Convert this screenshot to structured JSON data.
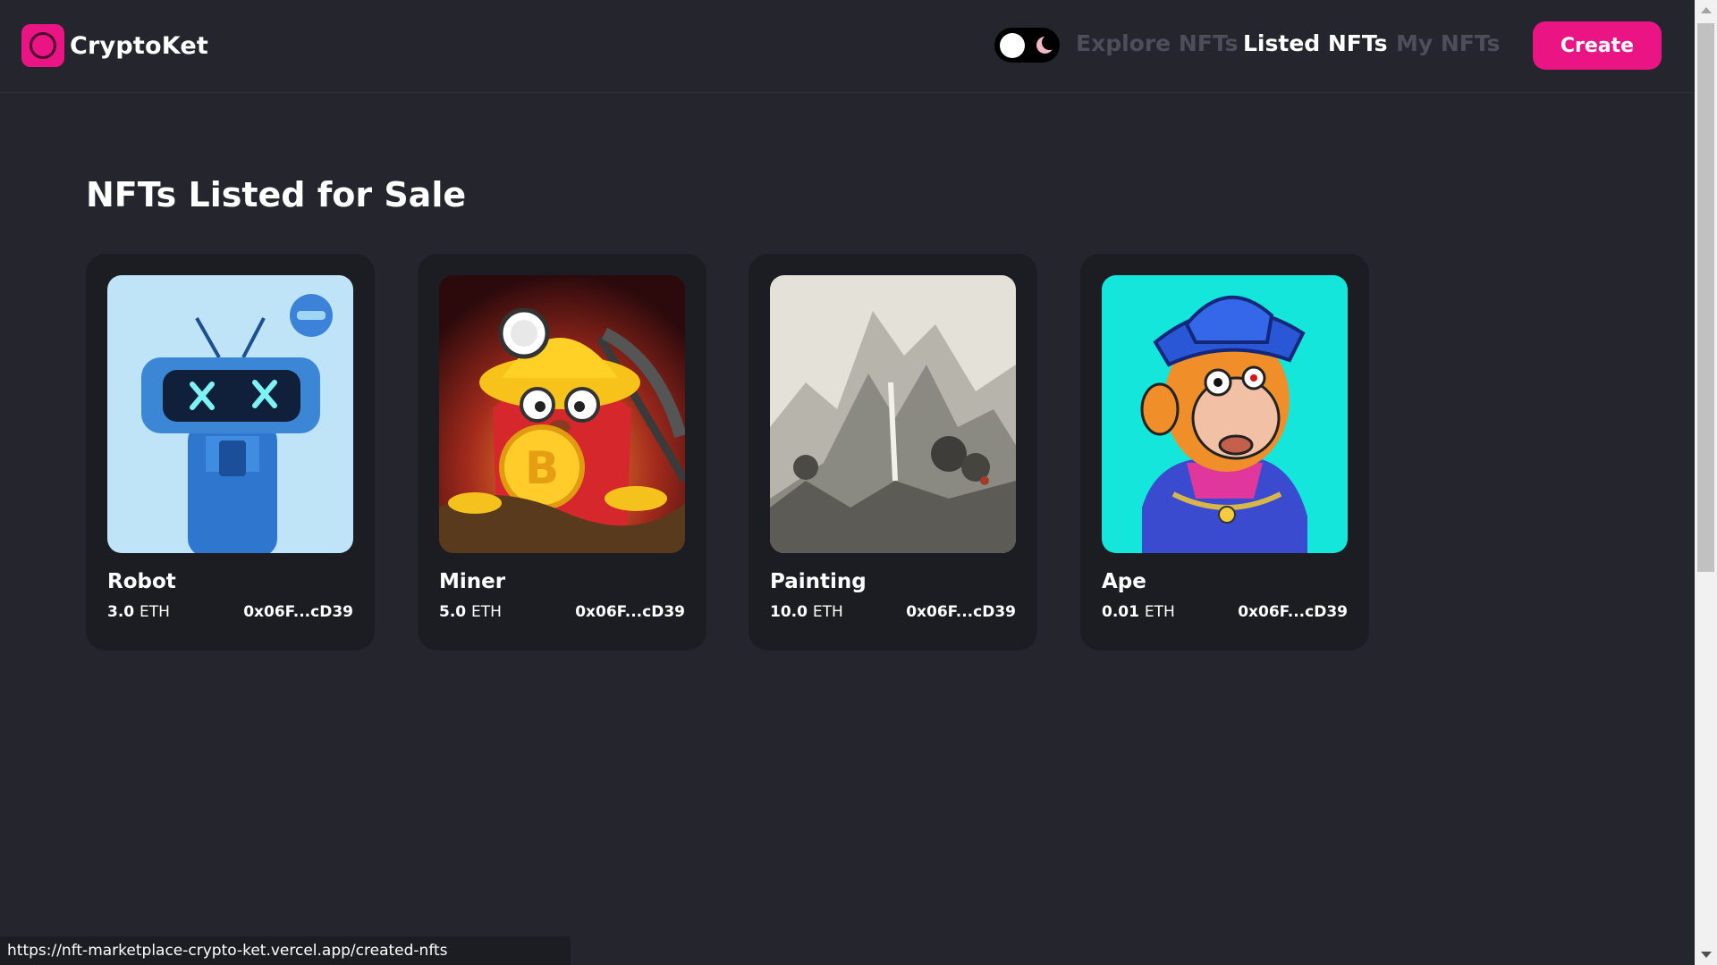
{
  "brand": {
    "name": "CryptoKet",
    "color": "#eb1484"
  },
  "nav": {
    "theme_toggle": "dark",
    "links": [
      {
        "label": "Explore NFTs",
        "state": "muted"
      },
      {
        "label": "Listed NFTs",
        "state": "active"
      },
      {
        "label": "My NFTs",
        "state": "muted"
      }
    ],
    "create_label": "Create"
  },
  "main": {
    "title": "NFTs Listed for Sale",
    "cards": [
      {
        "name": "Robot",
        "price": "3.0",
        "unit": "ETH",
        "owner": "0x06F...cD39"
      },
      {
        "name": "Miner",
        "price": "5.0",
        "unit": "ETH",
        "owner": "0x06F...cD39"
      },
      {
        "name": "Painting",
        "price": "10.0",
        "unit": "ETH",
        "owner": "0x06F...cD39"
      },
      {
        "name": "Ape",
        "price": "0.01",
        "unit": "ETH",
        "owner": "0x06F...cD39"
      }
    ]
  },
  "status": {
    "url": "https://nft-marketplace-crypto-ket.vercel.app/created-nfts"
  },
  "colors": {
    "background": "#24252d",
    "card": "#1c1d23",
    "accent": "#eb1484",
    "muted_text": "#4d4e57"
  }
}
